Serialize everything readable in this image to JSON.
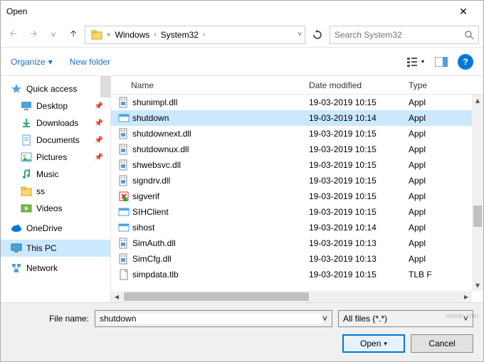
{
  "title": "Open",
  "breadcrumb": {
    "seg1": "Windows",
    "seg2": "System32"
  },
  "search": {
    "placeholder": "Search System32"
  },
  "toolbar": {
    "organize": "Organize",
    "newfolder": "New folder"
  },
  "sidebar": {
    "quick": "Quick access",
    "items": [
      {
        "label": "Desktop",
        "pin": true
      },
      {
        "label": "Downloads",
        "pin": true
      },
      {
        "label": "Documents",
        "pin": true
      },
      {
        "label": "Pictures",
        "pin": true
      },
      {
        "label": "Music",
        "pin": false
      },
      {
        "label": "ss",
        "pin": false
      },
      {
        "label": "Videos",
        "pin": false
      }
    ],
    "onedrive": "OneDrive",
    "thispc": "This PC",
    "network": "Network"
  },
  "columns": {
    "name": "Name",
    "date": "Date modified",
    "type": "Type"
  },
  "files": [
    {
      "name": "shunimpl.dll",
      "date": "19-03-2019 10:15",
      "type": "Appl",
      "icon": "dll",
      "sel": false
    },
    {
      "name": "shutdown",
      "date": "19-03-2019 10:14",
      "type": "Appl",
      "icon": "exe",
      "sel": true
    },
    {
      "name": "shutdownext.dll",
      "date": "19-03-2019 10:15",
      "type": "Appl",
      "icon": "dll",
      "sel": false
    },
    {
      "name": "shutdownux.dll",
      "date": "19-03-2019 10:15",
      "type": "Appl",
      "icon": "dll",
      "sel": false
    },
    {
      "name": "shwebsvc.dll",
      "date": "19-03-2019 10:15",
      "type": "Appl",
      "icon": "dll",
      "sel": false
    },
    {
      "name": "signdrv.dll",
      "date": "19-03-2019 10:15",
      "type": "Appl",
      "icon": "dll",
      "sel": false
    },
    {
      "name": "sigverif",
      "date": "19-03-2019 10:15",
      "type": "Appl",
      "icon": "sig",
      "sel": false
    },
    {
      "name": "SIHClient",
      "date": "19-03-2019 10:15",
      "type": "Appl",
      "icon": "exe",
      "sel": false
    },
    {
      "name": "sihost",
      "date": "19-03-2019 10:14",
      "type": "Appl",
      "icon": "exe",
      "sel": false
    },
    {
      "name": "SimAuth.dll",
      "date": "19-03-2019 10:13",
      "type": "Appl",
      "icon": "dll",
      "sel": false
    },
    {
      "name": "SimCfg.dll",
      "date": "19-03-2019 10:13",
      "type": "Appl",
      "icon": "dll",
      "sel": false
    },
    {
      "name": "simpdata.tlb",
      "date": "19-03-2019 10:15",
      "type": "TLB F",
      "icon": "file",
      "sel": false
    }
  ],
  "footer": {
    "filename_label": "File name:",
    "filename_value": "shutdown",
    "filter": "All files (*.*)",
    "open": "Open",
    "cancel": "Cancel"
  },
  "watermark": "wsxdn.com"
}
